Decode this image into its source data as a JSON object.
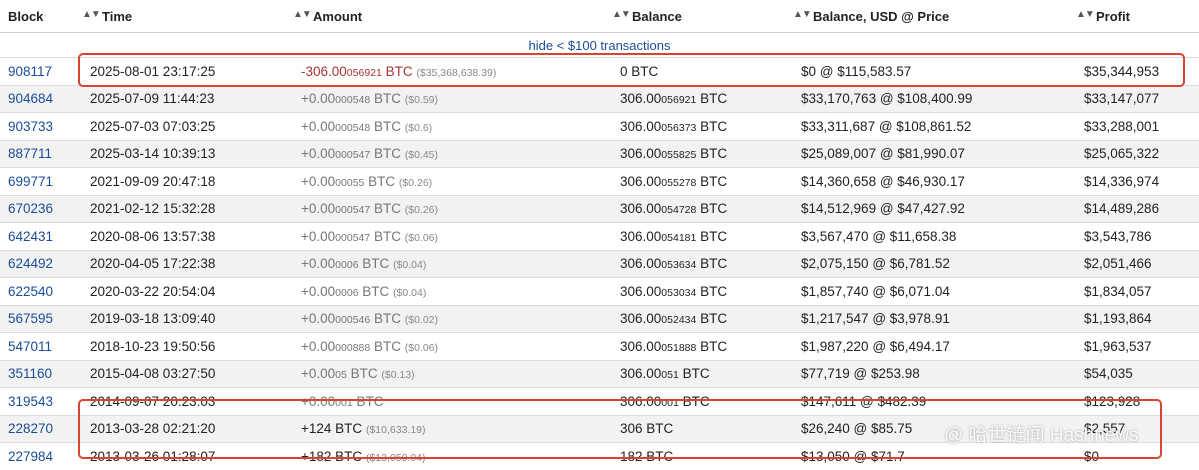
{
  "headers": {
    "block": "Block",
    "time": "Time",
    "amount": "Amount",
    "balance": "Balance",
    "balance_usd": "Balance, USD @ Price",
    "profit": "Profit"
  },
  "hide_link": "hide < $100 transactions",
  "rows": [
    {
      "block": "908117",
      "time": "2025-08-01 23:17:25",
      "amount_main": "-306.00",
      "amount_small": "056921",
      "amount_unit": " BTC",
      "amount_usd": "($35,368,638.39)",
      "amount_negative": true,
      "balance_main": "0 BTC",
      "balance_small": "",
      "balance_unit": "",
      "balance_usd": "$0 @ $115,583.57",
      "profit": "$35,344,953"
    },
    {
      "block": "904684",
      "time": "2025-07-09 11:44:23",
      "amount_main": "+0.00",
      "amount_small": "000548",
      "amount_unit": " BTC",
      "amount_usd": "($0.59)",
      "balance_main": "306.00",
      "balance_small": "056921",
      "balance_unit": " BTC",
      "balance_usd": "$33,170,763 @ $108,400.99",
      "profit": "$33,147,077"
    },
    {
      "block": "903733",
      "time": "2025-07-03 07:03:25",
      "amount_main": "+0.00",
      "amount_small": "000548",
      "amount_unit": " BTC",
      "amount_usd": "($0.6)",
      "balance_main": "306.00",
      "balance_small": "056373",
      "balance_unit": " BTC",
      "balance_usd": "$33,311,687 @ $108,861.52",
      "profit": "$33,288,001"
    },
    {
      "block": "887711",
      "time": "2025-03-14 10:39:13",
      "amount_main": "+0.00",
      "amount_small": "000547",
      "amount_unit": " BTC",
      "amount_usd": "($0.45)",
      "balance_main": "306.00",
      "balance_small": "055825",
      "balance_unit": " BTC",
      "balance_usd": "$25,089,007 @ $81,990.07",
      "profit": "$25,065,322"
    },
    {
      "block": "699771",
      "time": "2021-09-09 20:47:18",
      "amount_main": "+0.00",
      "amount_small": "00055",
      "amount_unit": " BTC",
      "amount_usd": "($0.26)",
      "balance_main": "306.00",
      "balance_small": "055278",
      "balance_unit": " BTC",
      "balance_usd": "$14,360,658 @ $46,930.17",
      "profit": "$14,336,974"
    },
    {
      "block": "670236",
      "time": "2021-02-12 15:32:28",
      "amount_main": "+0.00",
      "amount_small": "000547",
      "amount_unit": " BTC",
      "amount_usd": "($0.26)",
      "balance_main": "306.00",
      "balance_small": "054728",
      "balance_unit": " BTC",
      "balance_usd": "$14,512,969 @ $47,427.92",
      "profit": "$14,489,286"
    },
    {
      "block": "642431",
      "time": "2020-08-06 13:57:38",
      "amount_main": "+0.00",
      "amount_small": "000547",
      "amount_unit": " BTC",
      "amount_usd": "($0.06)",
      "balance_main": "306.00",
      "balance_small": "054181",
      "balance_unit": " BTC",
      "balance_usd": "$3,567,470 @ $11,658.38",
      "profit": "$3,543,786"
    },
    {
      "block": "624492",
      "time": "2020-04-05 17:22:38",
      "amount_main": "+0.00",
      "amount_small": "0006",
      "amount_unit": " BTC",
      "amount_usd": "($0.04)",
      "balance_main": "306.00",
      "balance_small": "053634",
      "balance_unit": " BTC",
      "balance_usd": "$2,075,150 @ $6,781.52",
      "profit": "$2,051,466"
    },
    {
      "block": "622540",
      "time": "2020-03-22 20:54:04",
      "amount_main": "+0.00",
      "amount_small": "0006",
      "amount_unit": " BTC",
      "amount_usd": "($0.04)",
      "balance_main": "306.00",
      "balance_small": "053034",
      "balance_unit": " BTC",
      "balance_usd": "$1,857,740 @ $6,071.04",
      "profit": "$1,834,057"
    },
    {
      "block": "567595",
      "time": "2019-03-18 13:09:40",
      "amount_main": "+0.00",
      "amount_small": "000546",
      "amount_unit": " BTC",
      "amount_usd": "($0.02)",
      "balance_main": "306.00",
      "balance_small": "052434",
      "balance_unit": " BTC",
      "balance_usd": "$1,217,547 @ $3,978.91",
      "profit": "$1,193,864"
    },
    {
      "block": "547011",
      "time": "2018-10-23 19:50:56",
      "amount_main": "+0.00",
      "amount_small": "000888",
      "amount_unit": " BTC",
      "amount_usd": "($0.06)",
      "balance_main": "306.00",
      "balance_small": "051888",
      "balance_unit": " BTC",
      "balance_usd": "$1,987,220 @ $6,494.17",
      "profit": "$1,963,537"
    },
    {
      "block": "351160",
      "time": "2015-04-08 03:27:50",
      "amount_main": "+0.00",
      "amount_small": "05",
      "amount_unit": " BTC",
      "amount_usd": "($0.13)",
      "balance_main": "306.00",
      "balance_small": "051",
      "balance_unit": " BTC",
      "balance_usd": "$77,719 @ $253.98",
      "profit": "$54,035"
    },
    {
      "block": "319543",
      "time": "2014-09-07 20:23:03",
      "amount_main": "+0.00",
      "amount_small": "001",
      "amount_unit": " BTC",
      "amount_usd": "",
      "balance_main": "306.00",
      "balance_small": "001",
      "balance_unit": " BTC",
      "balance_usd": "$147,611 @ $482.39",
      "profit": "$123,928"
    },
    {
      "block": "228270",
      "time": "2013-03-28 02:21:20",
      "amount_main": "+124",
      "amount_small": "",
      "amount_unit": " BTC",
      "amount_usd": "($10,633.19)",
      "amount_dark": true,
      "balance_main": "306 BTC",
      "balance_small": "",
      "balance_unit": "",
      "balance_usd": "$26,240 @ $85.75",
      "profit": "$2,557"
    },
    {
      "block": "227984",
      "time": "2013-03-26 01:28:07",
      "amount_main": "+182",
      "amount_small": "",
      "amount_unit": " BTC",
      "amount_usd": "($13,050.04)",
      "amount_dark": true,
      "balance_main": "182 BTC",
      "balance_small": "",
      "balance_unit": "",
      "balance_usd": "$13,050 @ $71.7",
      "profit": "$0"
    }
  ],
  "watermark": "@ 哈世链闻 Hashnews",
  "colors": {
    "link": "#1a4d99",
    "highlight": "#d9442f",
    "negative": "#a33333",
    "positive": "#777777"
  }
}
